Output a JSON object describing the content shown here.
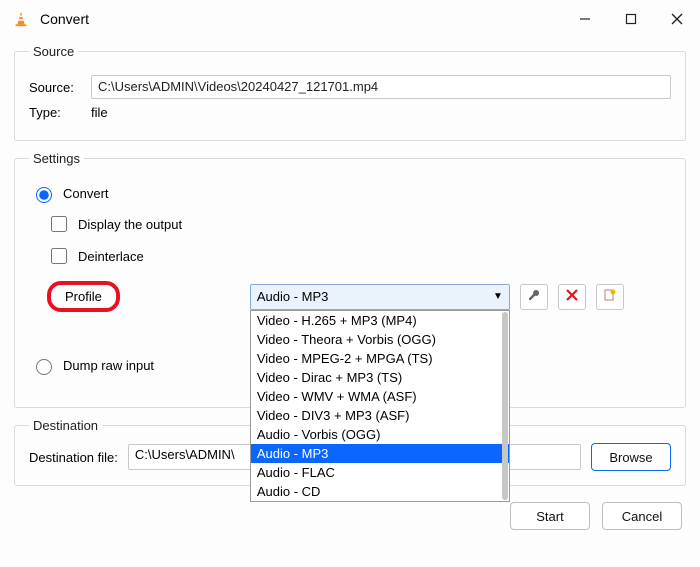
{
  "window": {
    "title": "Convert"
  },
  "source_group": {
    "legend": "Source",
    "source_label": "Source:",
    "source_value": "C:\\Users\\ADMIN\\Videos\\20240427_121701.mp4",
    "type_label": "Type:",
    "type_value": "file"
  },
  "settings_group": {
    "legend": "Settings",
    "convert_label": "Convert",
    "display_output_label": "Display the output",
    "deinterlace_label": "Deinterlace",
    "profile_label": "Profile",
    "profile_selected": "Audio - MP3",
    "profile_options": [
      "Video - H.265 + MP3 (MP4)",
      "Video - Theora + Vorbis (OGG)",
      "Video - MPEG-2 + MPGA (TS)",
      "Video - Dirac + MP3 (TS)",
      "Video - WMV + WMA (ASF)",
      "Video - DIV3 + MP3 (ASF)",
      "Audio - Vorbis (OGG)",
      "Audio - MP3",
      "Audio - FLAC",
      "Audio - CD"
    ],
    "dump_label": "Dump raw input"
  },
  "destination_group": {
    "legend": "Destination",
    "dest_label": "Destination file:",
    "dest_value": "C:\\Users\\ADMIN\\",
    "browse_label": "Browse"
  },
  "footer": {
    "start_label": "Start",
    "cancel_label": "Cancel"
  }
}
